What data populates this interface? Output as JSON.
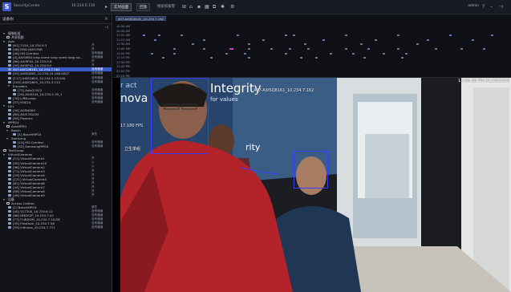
{
  "app": {
    "logo_letter": "S"
  },
  "topbar": {
    "server_label": "SecurityCenter",
    "ip_label": "10.234.0.110",
    "tabs": [
      "实时画面",
      "回放"
    ],
    "extra_label": "搜索和报警",
    "user": "admin",
    "icons": [
      "home-icon",
      "layout-icon",
      "bookmark-icon",
      "grid-icon",
      "settings-icon",
      "help-icon",
      "pin-icon"
    ]
  },
  "sidebar": {
    "title": "设备树",
    "rows": [
      {
        "indent": 4,
        "icon": "tri",
        "label": "摄像机组",
        "status": ""
      },
      {
        "indent": 8,
        "icon": "fold",
        "label": "共享视图",
        "status": ""
      },
      {
        "indent": 4,
        "icon": "tri",
        "label": "Axis",
        "status": ""
      },
      {
        "indent": 10,
        "icon": "cam",
        "label": "[61] 215A_10.234.9.3",
        "status": "开"
      },
      {
        "indent": 10,
        "icon": "cam",
        "label": "[96] M50-VA557NB",
        "status": "开"
      },
      {
        "indent": 10,
        "icon": "cam",
        "label": "[40] HD-Corridor",
        "status": "没有通道"
      },
      {
        "indent": 10,
        "icon": "cam",
        "label": "[4] AXISM50 long name long name long na...",
        "status": "没有通道"
      },
      {
        "indent": 10,
        "icon": "cam",
        "label": "[66] AXISP42_10.234.9.8",
        "status": "开"
      },
      {
        "indent": 10,
        "icon": "cam",
        "label": "[55] AXISP42_10.234.9.9",
        "status": "开"
      },
      {
        "indent": 10,
        "icon": "cam",
        "label": "407-AXISQ8161_10.234.7.162",
        "status": "没有通道",
        "selected": true
      },
      {
        "indent": 10,
        "icon": "cam",
        "label": "[93] AXISQ605_10.234.10.168.0007",
        "status": "没有通道"
      },
      {
        "indent": 10,
        "icon": "cam",
        "label": "[117] AXISQ605_10.234.2.13/100",
        "status": "没有通道"
      },
      {
        "indent": 10,
        "icon": "cam",
        "label": "[105] AXISQ605_10.234.3.115",
        "status": "没有通道"
      },
      {
        "indent": 10,
        "icon": "tri",
        "label": "Encoders",
        "status": ""
      },
      {
        "indent": 16,
        "icon": "cam",
        "label": "[73] AxisQ7412",
        "status": "没有通道"
      },
      {
        "indent": 16,
        "icon": "cam",
        "label": "[24] AXIS244_10.234.5.39_1",
        "status": "没有通道"
      },
      {
        "indent": 10,
        "icon": "cam",
        "label": "[70] L/RB.ovap",
        "status": "没有通道"
      },
      {
        "indent": 10,
        "icon": "cam",
        "label": "[57] M3024",
        "status": "没有通道"
      },
      {
        "indent": 4,
        "icon": "tri",
        "label": "DVL",
        "status": ""
      },
      {
        "indent": 10,
        "icon": "cam",
        "label": "[50] ACM4000",
        "status": ""
      },
      {
        "indent": 10,
        "icon": "cam",
        "label": "[80] AXIS M1034",
        "status": ""
      },
      {
        "indent": 10,
        "icon": "cam",
        "label": "[95] Phoenix",
        "status": ""
      },
      {
        "indent": 4,
        "icon": "tri",
        "label": "MPEG4",
        "status": ""
      },
      {
        "indent": 8,
        "icon": "fold",
        "label": "AxisMPEG",
        "status": ""
      },
      {
        "indent": 8,
        "icon": "tri",
        "label": "Bosch",
        "status": ""
      },
      {
        "indent": 16,
        "icon": "cam",
        "label": "[1] BoschMPG4",
        "status": "某些"
      },
      {
        "indent": 8,
        "icon": "tri",
        "label": "Samsung",
        "status": ""
      },
      {
        "indent": 16,
        "icon": "cam",
        "label": "[14] HD-Corridor",
        "status": "没有通道"
      },
      {
        "indent": 16,
        "icon": "cam",
        "label": "[52] SamsungMPG4",
        "status": "没有通道"
      },
      {
        "indent": 4,
        "icon": "fold",
        "label": "TestGroup",
        "status": ""
      },
      {
        "indent": 4,
        "icon": "tri",
        "label": "VirtualCameras",
        "status": ""
      },
      {
        "indent": 10,
        "icon": "cam",
        "label": "[11] VirtualCamera1",
        "status": "开"
      },
      {
        "indent": 10,
        "icon": "cam",
        "label": "[92] VirtualCamera10",
        "status": "开",
        "status_grey": true
      },
      {
        "indent": 10,
        "icon": "cam",
        "label": "[96] VirtualCamera2",
        "status": "开",
        "status_grey": true
      },
      {
        "indent": 10,
        "icon": "cam",
        "label": "[71] VirtualCamera3",
        "status": "开"
      },
      {
        "indent": 10,
        "icon": "cam",
        "label": "[29] VirtualCamera4",
        "status": "开"
      },
      {
        "indent": 10,
        "icon": "cam",
        "label": "[121] VirtualCamera5",
        "status": "开"
      },
      {
        "indent": 10,
        "icon": "cam",
        "label": "[81] VirtualCamera6",
        "status": "开"
      },
      {
        "indent": 10,
        "icon": "cam",
        "label": "[44] VirtualCamera7",
        "status": "开"
      },
      {
        "indent": 10,
        "icon": "cam",
        "label": "[58] VirtualCamera8",
        "status": "开"
      },
      {
        "indent": 10,
        "icon": "cam",
        "label": "[49] VirtualCamera9",
        "status": "开"
      },
      {
        "indent": 4,
        "icon": "tri",
        "label": "设备",
        "status": ""
      },
      {
        "indent": 8,
        "icon": "fold",
        "label": "Access Control",
        "status": ""
      },
      {
        "indent": 10,
        "icon": "cam",
        "label": "[1] BoschMPG4",
        "status": "某些"
      },
      {
        "indent": 10,
        "icon": "cam",
        "label": "[40] 5C7200_10.234.6.12",
        "status": "没有通道"
      },
      {
        "indent": 10,
        "icon": "cam",
        "label": "[66] DNDS2P_10.234.7.42",
        "status": "没有通道"
      },
      {
        "indent": 10,
        "icon": "cam",
        "label": "[77] FLIRDOM_10.234.7.10/28",
        "status": "没有通道"
      },
      {
        "indent": 10,
        "icon": "cam",
        "label": "[35] FlexDom_10.234.7.58",
        "status": "没有通道"
      },
      {
        "indent": 10,
        "icon": "cam",
        "label": "[29] Infinova_10.234.7.771",
        "status": "没有通道"
      }
    ]
  },
  "timeline": {
    "tab_label": "407-AXISQ8161_10.234.7.162",
    "rows": [
      {
        "time": "10:30 AM",
        "marks": []
      },
      {
        "time": "10:45 AM",
        "marks": []
      },
      {
        "time": "11:00 AM",
        "marks": [
          0.02,
          0.06,
          0.12,
          0.27,
          0.4,
          0.42,
          0.56,
          0.7,
          0.84,
          0.95
        ]
      },
      {
        "time": "11:15 AM",
        "marks": [
          0.05,
          0.18,
          0.34,
          0.5,
          0.64,
          0.78,
          0.9
        ]
      },
      {
        "time": "11:30 AM",
        "marks": [
          0.15,
          0.3,
          0.45,
          0.6,
          0.75
        ]
      },
      {
        "time": "11:45 AM",
        "marks": [
          0.1,
          0.18,
          0.25,
          0.3,
          0.36,
          0.41,
          0.46,
          0.56,
          0.62,
          0.7,
          0.8,
          0.87,
          0.93
        ],
        "pink": [
          0.25
        ]
      },
      {
        "time": "12:00 PM",
        "marks": [
          0.04,
          0.1,
          0.24,
          0.29,
          0.4,
          0.52,
          0.58,
          0.66,
          0.72
        ]
      },
      {
        "time": "12:15 PM",
        "marks": [
          0.07,
          0.2,
          0.3,
          0.44,
          0.48,
          0.61,
          0.71
        ]
      },
      {
        "time": "12:30 PM",
        "marks": []
      },
      {
        "time": "12:45 PM",
        "marks": []
      },
      {
        "time": "01:00 PM",
        "marks": []
      },
      {
        "time": "01:15 PM",
        "marks": []
      }
    ]
  },
  "video": {
    "camera_title": "407-AXISQ8161_10.234.7.162",
    "timestamp": "12:06:30 PM 01/26/2018",
    "fps": "17.180 FPS",
    "overlay_left": "立生单组"
  }
}
